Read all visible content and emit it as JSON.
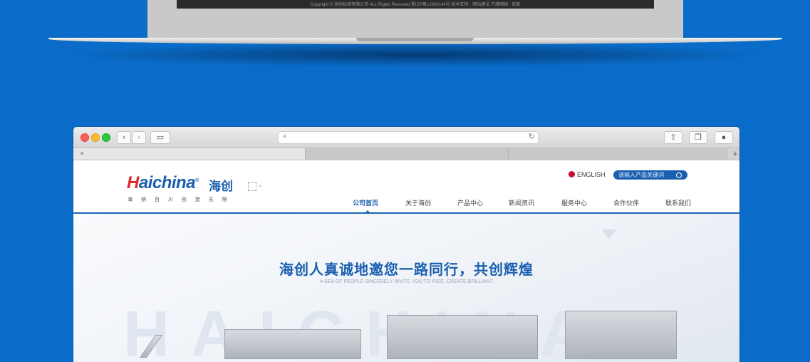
{
  "laptop": {
    "footer_text": "Copyright © 海创机械有限公司 ALL Rights Reserved 浙ICP备12000144号 技术支持：网站建设 万维网络 - 百度"
  },
  "browser": {
    "address_icon": "reader-icon",
    "reload_icon": "reload-icon",
    "tab_close": "×",
    "tab_new": "+"
  },
  "site": {
    "logo": {
      "h_letter": "H",
      "rest_letters": "aichina",
      "registered": "®",
      "chinese": "海创",
      "tagline": "海 纳 百 川    创 造 无 限"
    },
    "lang_label": "ENGLISH",
    "search_placeholder": "请输入产品关键词",
    "nav": [
      {
        "label": "公司首页",
        "active": true
      },
      {
        "label": "关于海创"
      },
      {
        "label": "产品中心"
      },
      {
        "label": "新闻资讯"
      },
      {
        "label": "服务中心"
      },
      {
        "label": "合作伙伴"
      },
      {
        "label": "联系我们"
      }
    ],
    "hero": {
      "title": "海创人真诚地邀您一路同行，共创辉煌",
      "subtitle": "A SEA OF PEOPLE SINCERELY INVITE YOU TO RIDE, CREATE BRILLIANT",
      "watermark": "HAICHINA"
    }
  },
  "colors": {
    "background": "#0a6cc8",
    "brand_blue": "#1b5fb0",
    "brand_red": "#e0262b"
  }
}
